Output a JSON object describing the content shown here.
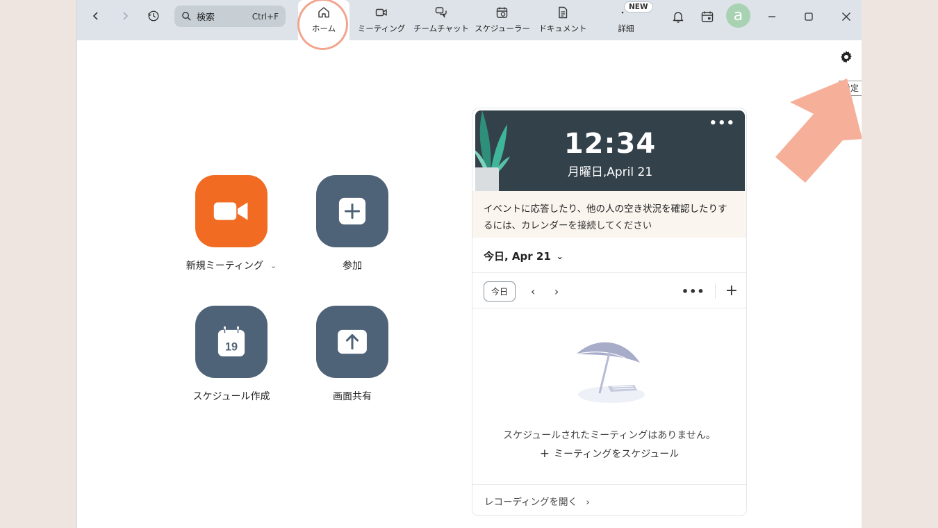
{
  "toolbar": {
    "search_label": "検索",
    "search_shortcut": "Ctrl+F",
    "tabs": [
      {
        "label": "ホーム"
      },
      {
        "label": "ミーティング"
      },
      {
        "label": "チームチャット"
      },
      {
        "label": "スケジューラー"
      },
      {
        "label": "ドキュメント"
      },
      {
        "label": "詳細"
      }
    ],
    "new_badge": "NEW",
    "avatar_letter": "a"
  },
  "settings_tooltip": "設定",
  "actions": [
    {
      "label": "新規ミーティング",
      "color": "#f26b22"
    },
    {
      "label": "参加",
      "color": "#4f6378"
    },
    {
      "label": "スケジュール作成",
      "color": "#4f6378",
      "calendar_day": "19"
    },
    {
      "label": "画面共有",
      "color": "#4f6378"
    }
  ],
  "calendar": {
    "time": "12:34",
    "date": "月曜日,April 21",
    "notice_line1": "イベントに応答したり、他の人の空き状況を確認したりす",
    "notice_line2_prefix": "るには、",
    "notice_link": "カレンダーを接続してください",
    "today_label": "今日, Apr 21",
    "today_button": "今日",
    "empty_text": "スケジュールされたミーティングはありません。",
    "schedule_link": "ミーティングをスケジュール",
    "recording_link": "レコーディングを開く"
  },
  "colors": {
    "accent_arrow": "#f6b09a",
    "header_dark": "#33414a"
  }
}
